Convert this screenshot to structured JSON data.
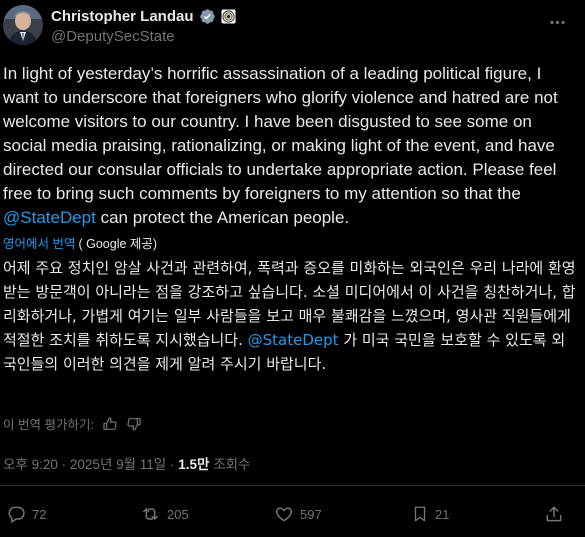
{
  "author": {
    "name": "Christopher Landau",
    "handle": "@DeputySecState"
  },
  "tweet": {
    "text_part1": "In light of yesterday’s horrific assassination of a leading political figure, I want to underscore that foreigners who glorify violence and hatred are not welcome visitors to our country. I have been disgusted to see some on social media praising, rationalizing, or making light of the event, and have directed our consular officials to undertake appropriate action. Please feel free to bring such comments by foreigners to my attention so that the ",
    "mention": "@StateDept",
    "text_part2": " can protect the American people."
  },
  "translation": {
    "link_label": "영어에서 번역",
    "provider": "( Google 제공)",
    "text_part1": "어제 주요 정치인 암살 사건과 관련하여, 폭력과 증오를 미화하는 외국인은 우리 나라에 환영받는 방문객이 아니라는 점을 강조하고 싶습니다. 소셜 미디어에서 이 사건을 칭찬하거나, 합리화하거나, 가볍게 여기는 일부 사람들을 보고 매우 불쾌감을 느꼈으며, 영사관 직원들에게 적절한 조치를 취하도록 지시했습니다. ",
    "mention": "@StateDept",
    "text_part2": " 가 미국 국민을 보호할 수 있도록 외국인들의 이러한 의견을 제게 알려 주시기 바랍니다.",
    "rate_label": "이 번역 평가하기:"
  },
  "meta": {
    "time": "오후 9:20",
    "date": "2025년 9월 11일",
    "views_count": "1.5만",
    "views_label": "조회수"
  },
  "actions": {
    "replies": "72",
    "reposts": "205",
    "likes": "597",
    "bookmarks": "21"
  },
  "colors": {
    "background": "#000000",
    "text": "#e7e9ea",
    "muted": "#71767b",
    "link": "#1d9bf0",
    "verified_badge": "#829aab"
  }
}
